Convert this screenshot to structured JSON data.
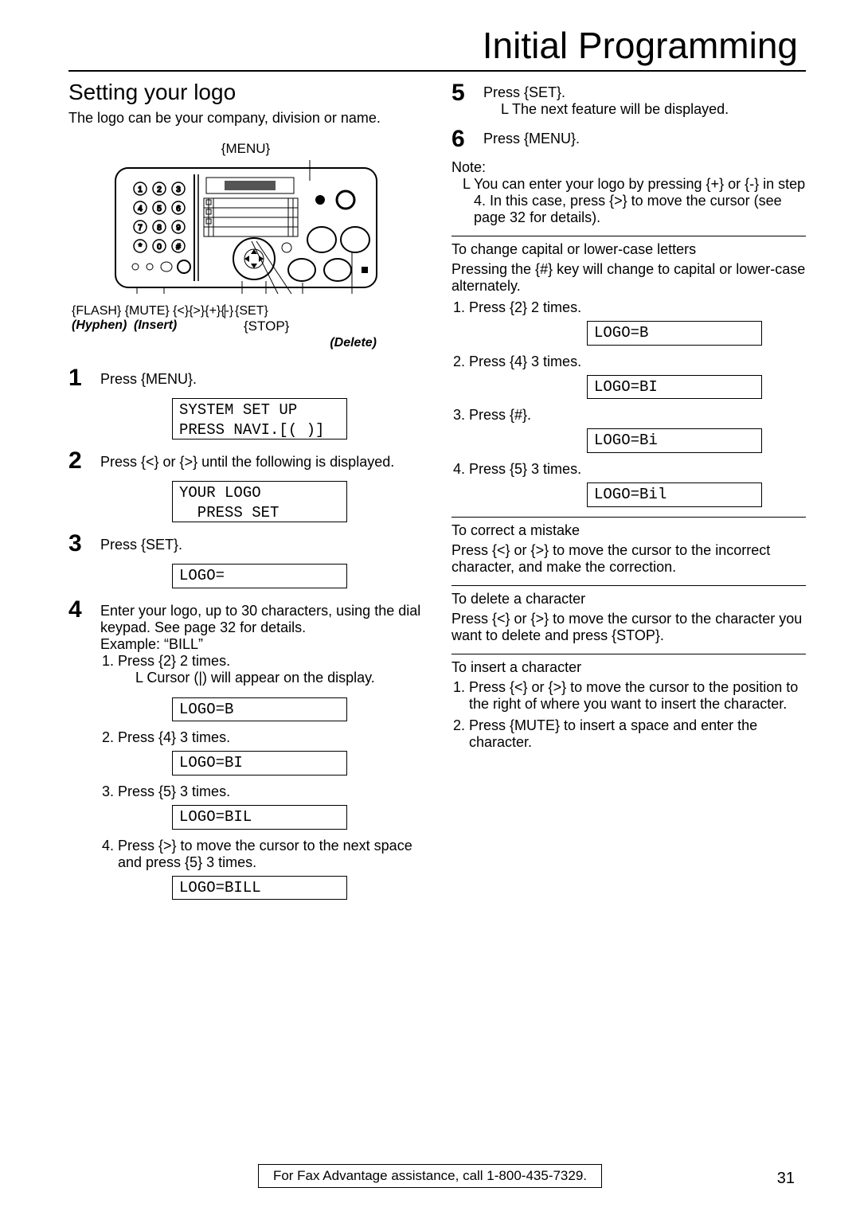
{
  "page_title": "Initial Programming",
  "section_heading": "Setting your logo",
  "intro": "The logo can be your company, division or name.",
  "diagram": {
    "menu": "{MENU}",
    "labels": "{FLASH} {MUTE} {<}{>}{+}{-}",
    "set": "{SET}",
    "hyphen": "(Hyphen)",
    "insert": "(Insert)",
    "stop": "{STOP}",
    "delete": "(Delete)"
  },
  "left_steps": {
    "s1": "Press {MENU}.",
    "lcd1a": "SYSTEM SET UP",
    "lcd1b": "PRESS NAVI.[( )]",
    "s2": "Press {<} or {>} until the following is displayed.",
    "lcd2a": "YOUR LOGO",
    "lcd2b": "  PRESS SET",
    "s3": "Press {SET}.",
    "lcd3": "LOGO=",
    "s4a": "Enter your logo, up to 30 characters, using the dial keypad. See page 32 for details.",
    "s4b": "Example:  “BILL”",
    "s4_1": "Press {2} 2 times.",
    "s4_1b": "L  Cursor (|) will appear on the display.",
    "lcd4_1": "LOGO=B",
    "s4_2": "Press {4} 3 times.",
    "lcd4_2": "LOGO=BI",
    "s4_3": "Press {5} 3 times.",
    "lcd4_3": "LOGO=BIL",
    "s4_4": "Press {>} to move the cursor to the next space and press {5} 3 times.",
    "lcd4_4": "LOGO=BILL"
  },
  "right": {
    "s5": "Press {SET}.",
    "s5b": "L  The next feature will be displayed.",
    "s6": "Press {MENU}.",
    "note_hdr": "Note:",
    "note_body": "L  You can enter your logo by pressing {+} or {-} in step 4. In this case, press {>} to move the cursor (see page 32 for details).",
    "cap_hdr": "To change capital or lower-case letters",
    "cap_body": "Pressing the {#} key will change to capital or lower-case alternately.",
    "cap_1": "Press {2} 2 times.",
    "lcd_c1": "LOGO=B",
    "cap_2": "Press {4} 3 times.",
    "lcd_c2": "LOGO=BI",
    "cap_3": "Press {#}.",
    "lcd_c3": "LOGO=Bi",
    "cap_4": "Press {5} 3 times.",
    "lcd_c4": "LOGO=Bil",
    "corr_hdr": "To correct a mistake",
    "corr_body": "Press {<} or {>} to move the cursor to the incorrect character, and make the correction.",
    "del_hdr": "To delete a character",
    "del_body": "Press {<} or {>} to move the cursor to the character you want to delete and press {STOP}.",
    "ins_hdr": "To insert a character",
    "ins_1": "Press {<} or {>} to move the cursor to the position to the right of where you want to insert the character.",
    "ins_2": "Press {MUTE} to insert a space and enter the character."
  },
  "footer": "For Fax Advantage assistance, call 1-800-435-7329.",
  "page_number": "31"
}
